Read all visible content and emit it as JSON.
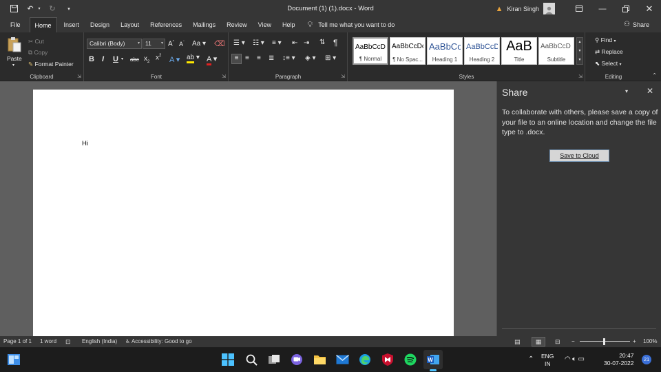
{
  "titlebar": {
    "title": "Document (1) (1).docx  -  Word",
    "user_name": "Kiran Singh"
  },
  "tabs": [
    "File",
    "Home",
    "Insert",
    "Design",
    "Layout",
    "References",
    "Mailings",
    "Review",
    "View",
    "Help"
  ],
  "tell_me": "Tell me what you want to do",
  "share_label": "Share",
  "clipboard": {
    "paste": "Paste",
    "cut": "Cut",
    "copy": "Copy",
    "format_painter": "Format Painter",
    "label": "Clipboard"
  },
  "font": {
    "name": "Calibri (Body)",
    "size": "11",
    "label": "Font"
  },
  "paragraph": {
    "label": "Paragraph"
  },
  "styles": {
    "label": "Styles",
    "items": [
      {
        "sample": "AaBbCcDc",
        "name": "¶ Normal"
      },
      {
        "sample": "AaBbCcDc",
        "name": "¶ No Spac..."
      },
      {
        "sample": "AaBbCc",
        "name": "Heading 1"
      },
      {
        "sample": "AaBbCcD",
        "name": "Heading 2"
      },
      {
        "sample": "AaB",
        "name": "Title"
      },
      {
        "sample": "AaBbCcD",
        "name": "Subtitle"
      }
    ]
  },
  "editing": {
    "find": "Find",
    "replace": "Replace",
    "select": "Select",
    "label": "Editing"
  },
  "document": {
    "text": "Hi"
  },
  "share_pane": {
    "title": "Share",
    "message": "To collaborate with others, please save a copy of your file to an online location and change the file type to .docx.",
    "button": "Save to Cloud"
  },
  "status": {
    "page": "Page 1 of 1",
    "words": "1 word",
    "language": "English (India)",
    "accessibility": "Accessibility: Good to go",
    "zoom": "100%"
  },
  "tray": {
    "lang_top": "ENG",
    "lang_bottom": "IN",
    "time": "20:47",
    "date": "30-07-2022",
    "badge": "21"
  },
  "colors": {
    "accent": "#2b579a",
    "warning": "#e8a33d",
    "badge": "#3a6fd8"
  }
}
